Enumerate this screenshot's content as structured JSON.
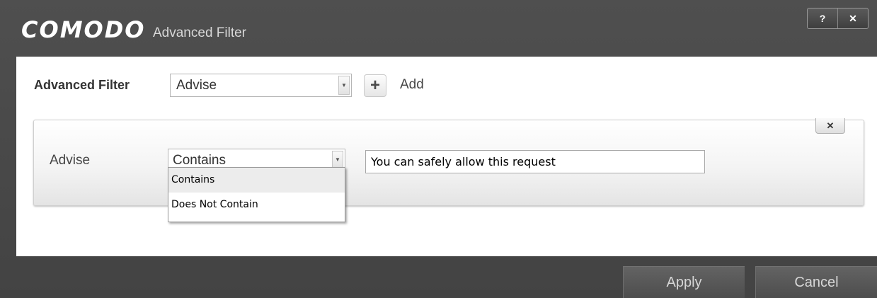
{
  "window": {
    "brand": "COMODO",
    "title": "Advanced Filter",
    "help_label": "?",
    "close_label": "✕"
  },
  "filter": {
    "label": "Advanced Filter",
    "selected": "Advise",
    "add_label": "Add"
  },
  "condition": {
    "field_label": "Advise",
    "operator_selected": "Contains",
    "operator_options": [
      "Contains",
      "Does Not Contain"
    ],
    "value": "You can safely allow this request",
    "remove_label": "✕"
  },
  "footer": {
    "apply_label": "Apply",
    "cancel_label": "Cancel"
  },
  "colors": {
    "chrome": "#484848",
    "content_bg": "#ffffff",
    "footer_button": "#5a5a5a"
  }
}
